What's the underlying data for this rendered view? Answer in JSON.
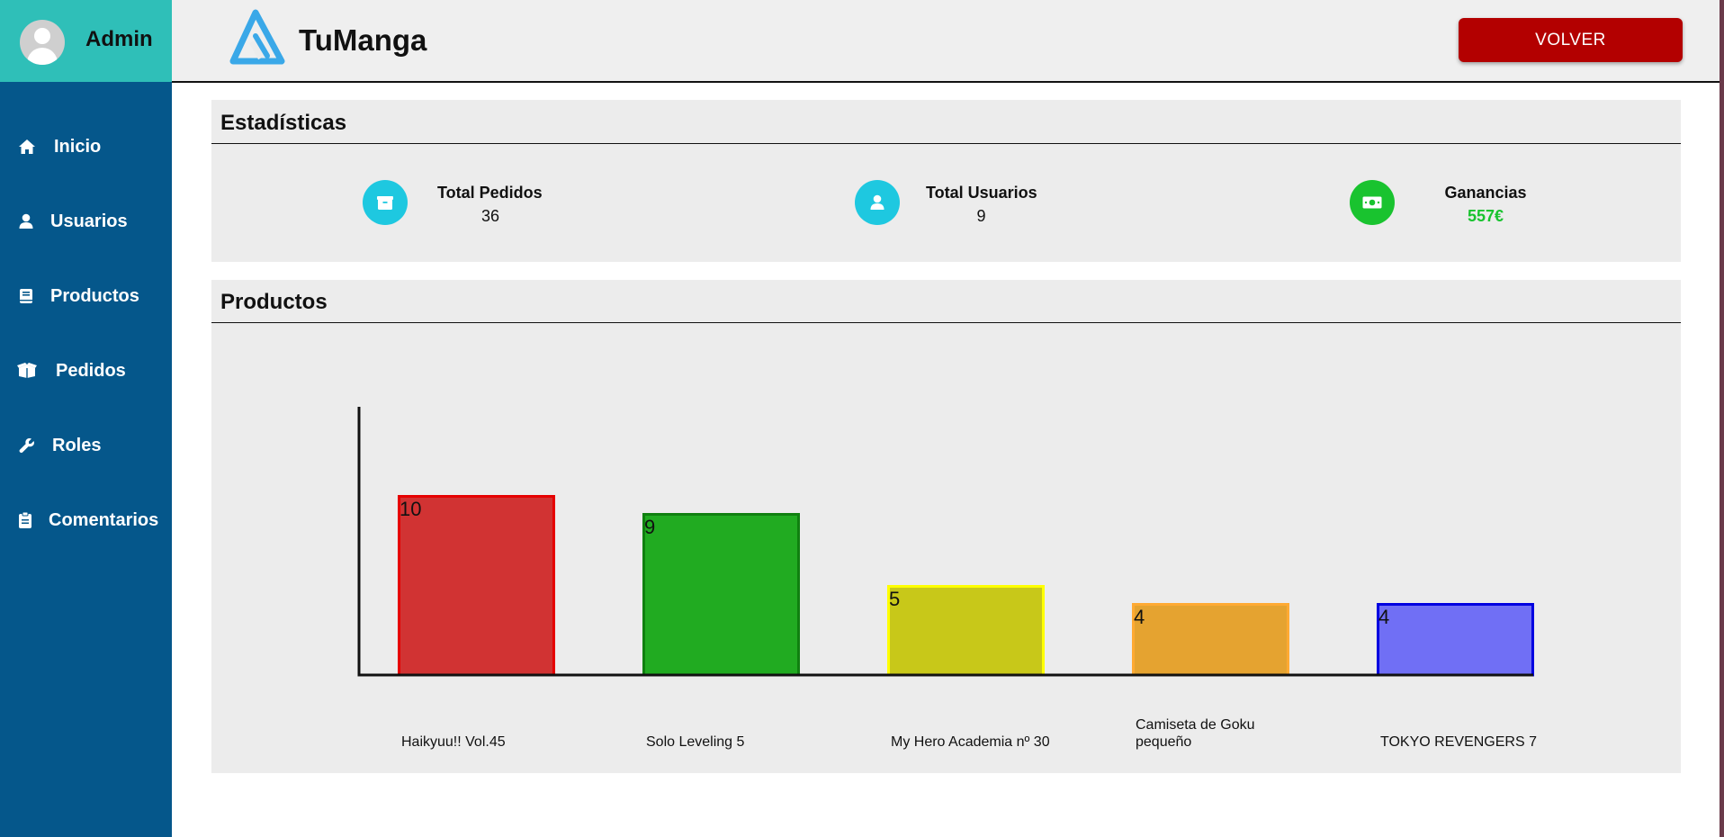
{
  "sidebar": {
    "user_name": "Admin",
    "items": [
      {
        "label": "Inicio",
        "icon": "home-icon"
      },
      {
        "label": "Usuarios",
        "icon": "user-icon"
      },
      {
        "label": "Productos",
        "icon": "book-icon"
      },
      {
        "label": "Pedidos",
        "icon": "box-icon"
      },
      {
        "label": "Roles",
        "icon": "wrench-icon"
      },
      {
        "label": "Comentarios",
        "icon": "clipboard-icon"
      }
    ]
  },
  "header": {
    "brand": "TuManga",
    "back_button": "VOLVER"
  },
  "stats": {
    "title": "Estadísticas",
    "items": [
      {
        "label": "Total Pedidos",
        "value": "36",
        "icon": "box-icon",
        "color": "#1ec8e0"
      },
      {
        "label": "Total Usuarios",
        "value": "9",
        "icon": "user-icon",
        "color": "#1ec8e0"
      },
      {
        "label": "Ganancias",
        "value": "557€",
        "icon": "money-icon",
        "color": "#19c32f"
      }
    ]
  },
  "products": {
    "title": "Productos"
  },
  "chart_data": {
    "type": "bar",
    "categories": [
      "Haikyuu!! Vol.45",
      "Solo Leveling 5",
      "My Hero Academia nº 30",
      "Camiseta de Goku pequeño",
      "TOKYO REVENGERS 7"
    ],
    "values": [
      10,
      9,
      5,
      4,
      4
    ],
    "colors": [
      "#d13333",
      "#21ab21",
      "#c8c819",
      "#e5a330",
      "#706ff5"
    ],
    "border_colors": [
      "#e60000",
      "#108010",
      "#ffff00",
      "#ffaa33",
      "#0000e0"
    ],
    "ylim": [
      0,
      14.9
    ],
    "grid": false
  },
  "colors": {
    "sidebar": "#05578b",
    "sidebar_header": "#2fbfb8",
    "volver_button": "#b30000",
    "earnings_value": "#19c32f"
  }
}
